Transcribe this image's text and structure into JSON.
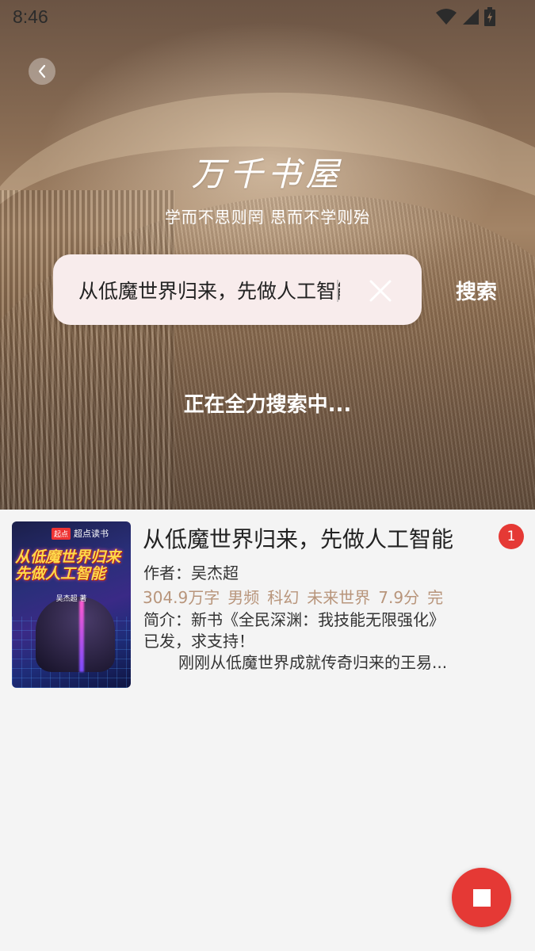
{
  "status_bar": {
    "time": "8:46"
  },
  "header": {
    "logo_text": "万千书屋",
    "slogan": "学而不思则罔 思而不学则殆"
  },
  "search": {
    "query": "从低魔世界归来，先做人工智能",
    "button_label": "搜索",
    "status_text": "正在全力搜索中..."
  },
  "results": [
    {
      "title": "从低魔世界归来，先做人工智能",
      "author": "作者：吴杰超",
      "meta": [
        "304.9万字",
        "男频",
        "科幻",
        "未来世界",
        "7.9分",
        "完"
      ],
      "intro_line1": "简介：新书《全民深渊：我技能无限强化》",
      "intro_line2": "已发，求支持！",
      "intro_line3": "刚刚从低魔世界成就传奇归来的王易...",
      "badge": "1",
      "cover": {
        "brand": "超点读书",
        "brand_tag": "起点",
        "title": "从低魔世界归来先做人工智能",
        "author": "吴杰超 著"
      }
    }
  ],
  "colors": {
    "accent": "#e53935",
    "meta_text": "#b8957b",
    "background": "#f4f4f4"
  },
  "icons": {
    "back": "chevron-left-icon",
    "clear": "close-icon",
    "stop": "stop-icon"
  }
}
